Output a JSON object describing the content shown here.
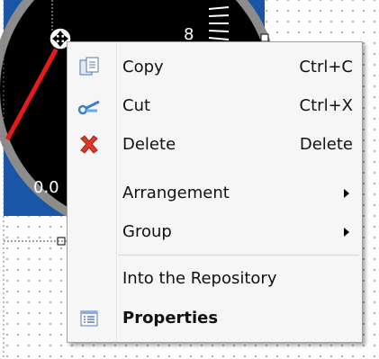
{
  "gauge": {
    "label_top": "8",
    "label_left": "0.0"
  },
  "menu": {
    "items": [
      {
        "label": "Copy",
        "shortcut": "Ctrl+C",
        "icon": "copy-icon"
      },
      {
        "label": "Cut",
        "shortcut": "Ctrl+X",
        "icon": "scissors-icon"
      },
      {
        "label": "Delete",
        "shortcut": "Delete",
        "icon": "delete-x-icon"
      },
      {
        "label": "Arrangement",
        "submenu": true
      },
      {
        "label": "Group",
        "submenu": true
      },
      {
        "label": "Into the Repository"
      },
      {
        "label": "Properties",
        "icon": "properties-list-icon",
        "bold": true
      }
    ]
  },
  "colors": {
    "gauge_blue": "#1a56a8",
    "gauge_face": "#000000",
    "needle": "#e8191a",
    "delete_icon": "#e0382a",
    "cut_icon": "#3a7fd0"
  }
}
